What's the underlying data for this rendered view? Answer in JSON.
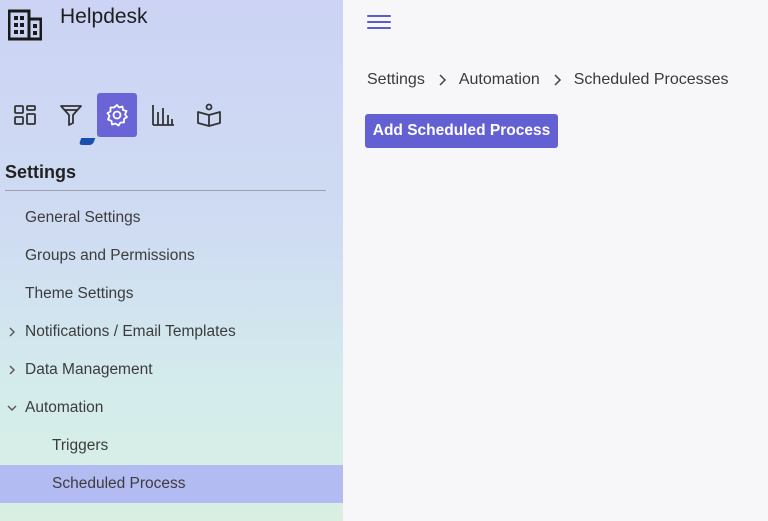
{
  "app": {
    "title": "Helpdesk",
    "logo_icon": "building-icon"
  },
  "icon_bar": [
    {
      "name": "dashboard-icon",
      "active": false
    },
    {
      "name": "filter-icon",
      "active": false
    },
    {
      "name": "gear-icon",
      "active": true
    },
    {
      "name": "bar-chart-icon",
      "active": false
    },
    {
      "name": "knowledge-book-icon",
      "active": false
    }
  ],
  "sidebar": {
    "section_title": "Settings",
    "items": [
      {
        "label": "General Settings",
        "caret": null,
        "level": 0,
        "selected": false
      },
      {
        "label": "Groups and Permissions",
        "caret": null,
        "level": 0,
        "selected": false
      },
      {
        "label": "Theme Settings",
        "caret": null,
        "level": 0,
        "selected": false
      },
      {
        "label": "Notifications / Email Templates",
        "caret": "right",
        "level": 0,
        "selected": false
      },
      {
        "label": "Data Management",
        "caret": "right",
        "level": 0,
        "selected": false
      },
      {
        "label": "Automation",
        "caret": "down",
        "level": 0,
        "selected": false
      },
      {
        "label": "Triggers",
        "caret": null,
        "level": 1,
        "selected": false
      },
      {
        "label": "Scheduled Process",
        "caret": null,
        "level": 1,
        "selected": true
      }
    ]
  },
  "header": {
    "menu_icon": "hamburger-menu-icon"
  },
  "breadcrumb": [
    "Settings",
    "Automation",
    "Scheduled Processes"
  ],
  "actions": {
    "add_label": "Add Scheduled Process"
  },
  "colors": {
    "accent": "#6360d4",
    "selected_item": "#b3bbf3",
    "hamburger": "#5a5fc8"
  }
}
